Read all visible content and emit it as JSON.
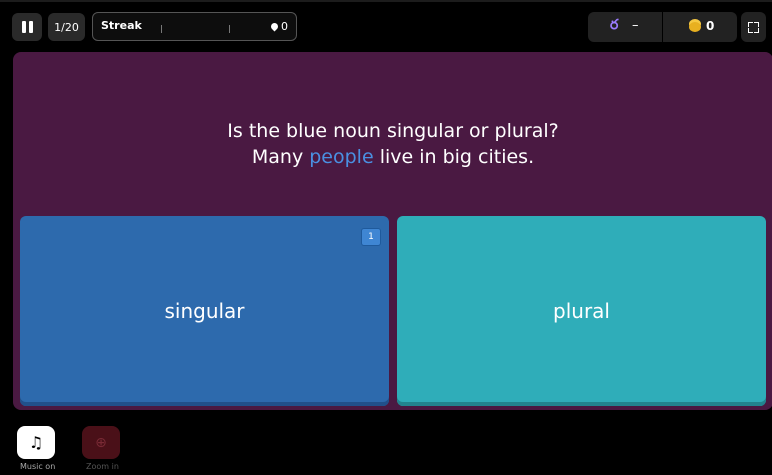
{
  "topbar": {
    "question_counter": "1/20",
    "streak_label": "Streak",
    "streak_count": "0",
    "medal_value": "–",
    "coins_value": "0"
  },
  "question": {
    "line1": "Is the blue noun singular or plural?",
    "line2_before": "Many ",
    "line2_highlight": "people",
    "line2_after": " live in big cities."
  },
  "answers": [
    {
      "label": "singular",
      "hotkey": "1",
      "color": "#2d6aad"
    },
    {
      "label": "plural",
      "color": "#2fadb9"
    }
  ],
  "bottom": {
    "music_label": "Music on",
    "zoom_label": "Zoom in"
  },
  "colors": {
    "panel": "#4a1942",
    "highlight": "#4a90e2"
  },
  "icons": {
    "pause": "pause-icon",
    "streak": "drop-icon",
    "medal": "medal-icon",
    "coins": "coins-icon",
    "fullscreen": "fullscreen-icon",
    "music": "music-note-icon",
    "zoom": "zoom-in-icon"
  }
}
